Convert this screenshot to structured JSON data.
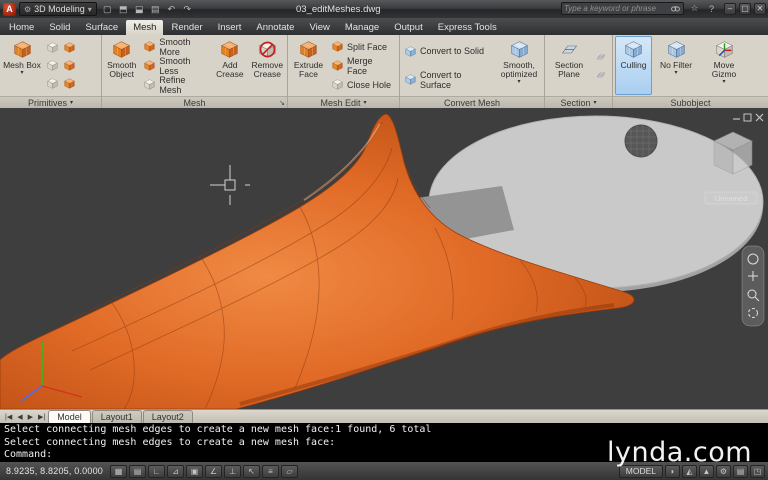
{
  "title": {
    "workspace": "3D Modeling",
    "filename": "03_editMeshes.dwg",
    "search_placeholder": "Type a keyword or phrase"
  },
  "icons": {
    "logo": "A",
    "gear": "⚙",
    "caret": "▾",
    "launcher": "↘",
    "new": "▢",
    "open": "⬒",
    "save": "⬓",
    "plot": "▤",
    "undo": "↶",
    "redo": "↷",
    "star": "☆",
    "help": "?",
    "min": "–",
    "restore": "▢",
    "close": "✕"
  },
  "menu": {
    "tabs": [
      "Home",
      "Solid",
      "Surface",
      "Mesh",
      "Render",
      "Insert",
      "Annotate",
      "View",
      "Manage",
      "Output",
      "Express Tools"
    ]
  },
  "ribbon": {
    "panel_labels": {
      "primitives": "Primitives",
      "mesh": "Mesh",
      "mesh_edit": "Mesh Edit",
      "convert_mesh": "Convert Mesh",
      "section": "Section",
      "subobject": "Subobject"
    },
    "buttons": {
      "mesh_box": "Mesh Box",
      "smooth_object": "Smooth Object",
      "smooth_more": "Smooth More",
      "smooth_less": "Smooth Less",
      "refine_mesh": "Refine Mesh",
      "add_crease": "Add Crease",
      "remove_crease": "Remove Crease",
      "extrude_face": "Extrude Face",
      "split_face": "Split Face",
      "merge_face": "Merge Face",
      "close_hole": "Close Hole",
      "convert_solid": "Convert to Solid",
      "convert_surface": "Convert to Surface",
      "smooth_optimized": "Smooth, optimized",
      "section_plane": "Section Plane",
      "culling": "Culling",
      "no_filter": "No Filter",
      "move_gizmo": "Move Gizmo"
    }
  },
  "viewport": {
    "viewcube_label": "Unnamed"
  },
  "layout": {
    "nav": [
      "|◀",
      "◀",
      "▶",
      "▶|"
    ],
    "tabs": [
      "Model",
      "Layout1",
      "Layout2"
    ]
  },
  "command": {
    "lines": [
      "Select connecting mesh edges to create a new mesh face:1 found, 6 total",
      "Select connecting mesh edges to create a new mesh face:",
      "Command:"
    ]
  },
  "status": {
    "coordinates": "8.9235, 8.8205, 0.0000",
    "model": "MODEL",
    "toggles": [
      {
        "name": "snap",
        "glyph": "▦"
      },
      {
        "name": "grid",
        "glyph": "▤"
      },
      {
        "name": "ortho",
        "glyph": "∟"
      },
      {
        "name": "polar",
        "glyph": "⊿"
      },
      {
        "name": "osnap",
        "glyph": "▣"
      },
      {
        "name": "otrack",
        "glyph": "∠"
      },
      {
        "name": "ducs",
        "glyph": "⊥"
      },
      {
        "name": "dyn",
        "glyph": "↖"
      },
      {
        "name": "lwt",
        "glyph": "≡"
      },
      {
        "name": "qp",
        "glyph": "▱"
      }
    ],
    "right_icons": [
      {
        "name": "annotation-visibility",
        "glyph": "◗"
      },
      {
        "name": "annotation-autoscale",
        "glyph": "◭"
      },
      {
        "name": "annotation-scale",
        "glyph": "▲"
      },
      {
        "name": "workspace-switch",
        "glyph": "⚙"
      },
      {
        "name": "toolbar-lock",
        "glyph": "▤"
      },
      {
        "name": "clean-screen",
        "glyph": "◳"
      }
    ]
  },
  "watermark": "lynda.com",
  "colors": {
    "accent_orange": "#e06a26",
    "selection_blue": "#a9cef0",
    "viewport_bg": "#3e3e3e"
  }
}
